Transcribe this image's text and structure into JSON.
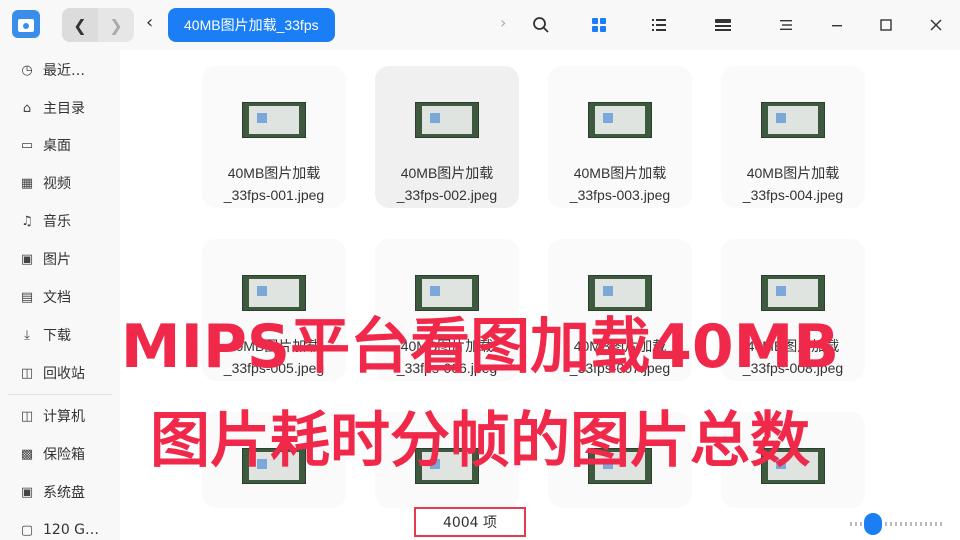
{
  "titlebar": {
    "breadcrumb": "40MB图片加载_33fps",
    "icons": [
      "search-icon",
      "icon-view-icon",
      "list-view-icon",
      "details-view-icon",
      "menu-icon",
      "minimize-icon",
      "maximize-icon",
      "close-icon"
    ]
  },
  "sidebar": {
    "items": [
      {
        "label": "最近…",
        "icon": "clock-icon"
      },
      {
        "label": "主目录",
        "icon": "home-icon"
      },
      {
        "label": "桌面",
        "icon": "desktop-icon"
      },
      {
        "label": "视频",
        "icon": "video-icon"
      },
      {
        "label": "音乐",
        "icon": "music-icon"
      },
      {
        "label": "图片",
        "icon": "picture-icon"
      },
      {
        "label": "文档",
        "icon": "document-icon"
      },
      {
        "label": "下载",
        "icon": "download-icon"
      },
      {
        "label": "回收站",
        "icon": "trash-icon"
      },
      {
        "label": "计算机",
        "icon": "computer-icon"
      },
      {
        "label": "保险箱",
        "icon": "vault-icon"
      },
      {
        "label": "系统盘",
        "icon": "disk-icon"
      },
      {
        "label": "120 G…",
        "icon": "drive-icon"
      }
    ]
  },
  "files": [
    {
      "line1": "40MB图片加载",
      "line2": "_33fps-001.jpeg"
    },
    {
      "line1": "40MB图片加载",
      "line2": "_33fps-002.jpeg"
    },
    {
      "line1": "40MB图片加载",
      "line2": "_33fps-003.jpeg"
    },
    {
      "line1": "40MB图片加载",
      "line2": "_33fps-004.jpeg"
    },
    {
      "line1": "40MB图片加载",
      "line2": "_33fps-005.jpeg"
    },
    {
      "line1": "40MB图片加载",
      "line2": "_33fps-006.jpeg"
    },
    {
      "line1": "40MB图片加载",
      "line2": "_33fps-007.jpeg"
    },
    {
      "line1": "40MB图片加载",
      "line2": "_33fps-008.jpeg"
    }
  ],
  "overlay": {
    "line1": "MIPS平台看图加载40MB",
    "line2": "图片耗时分帧的图片总数"
  },
  "status": {
    "count": "4004 项"
  },
  "colors": {
    "accent": "#1c7ef5",
    "overlay_text": "#f0284a",
    "status_border": "#e53a4f"
  }
}
